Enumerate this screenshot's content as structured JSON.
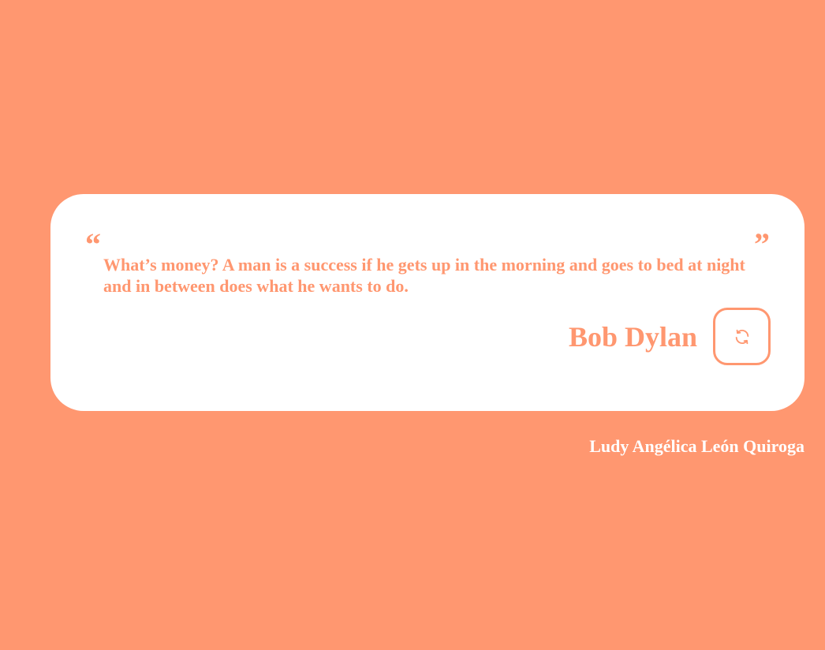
{
  "quote": {
    "open_mark": "“",
    "close_mark": "”",
    "text": "What’s money? A man is a success if he gets up in the morning and goes to bed at night and in between does what he wants to do.",
    "author": "Bob Dylan"
  },
  "refresh_button": {
    "icon": "refresh-icon"
  },
  "footer": {
    "credit": "Ludy Angélica León Quiroga"
  },
  "colors": {
    "background": "#FF9770",
    "card": "#FFFFFF",
    "accent": "#FF9770"
  }
}
